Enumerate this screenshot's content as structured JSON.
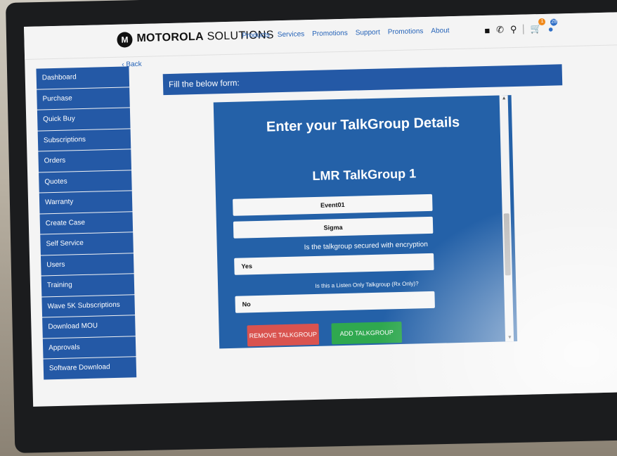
{
  "header": {
    "brand_bold": "MOTOROLA",
    "brand_rest": " SOLUTIONS",
    "logo_mark": "M",
    "nav": [
      "Products",
      "Services",
      "Promotions",
      "Support",
      "Promotions",
      "About"
    ],
    "cart_badge": "1",
    "user_badge": "28"
  },
  "back_label": "Back",
  "sidebar": {
    "items": [
      "Dashboard",
      "Purchase",
      "Quick Buy",
      "Subscriptions",
      "Orders",
      "Quotes",
      "Warranty",
      "Create Case",
      "Self Service",
      "Users",
      "Training",
      "Wave 5K Subscriptions",
      "Download MOU",
      "Approvals",
      "Software Download"
    ]
  },
  "form_bar": {
    "title": "Fill the below form:"
  },
  "form": {
    "heading": "Enter your TalkGroup Details",
    "subheading": "LMR TalkGroup 1",
    "field_name": "Event01",
    "field_agency": "Sigma",
    "q_encryption": "Is the talkgroup secured with encryption",
    "encryption_value": "Yes",
    "q_listen_only": "Is this a Listen Only Talkgroup (Rx Only)?",
    "listen_only_value": "No",
    "remove_label": "REMOVE TALKGROUP",
    "add_label": "ADD TALKGROUP"
  },
  "colors": {
    "primary_blue": "#2459a6",
    "panel_blue": "#2461a8",
    "danger_red": "#d9534f",
    "success_green": "#2fa84f",
    "badge_orange": "#f08a1d"
  },
  "icons": [
    "chat-icon",
    "phone-icon",
    "search-icon",
    "cart-icon",
    "user-icon",
    "chevron-left-icon"
  ]
}
